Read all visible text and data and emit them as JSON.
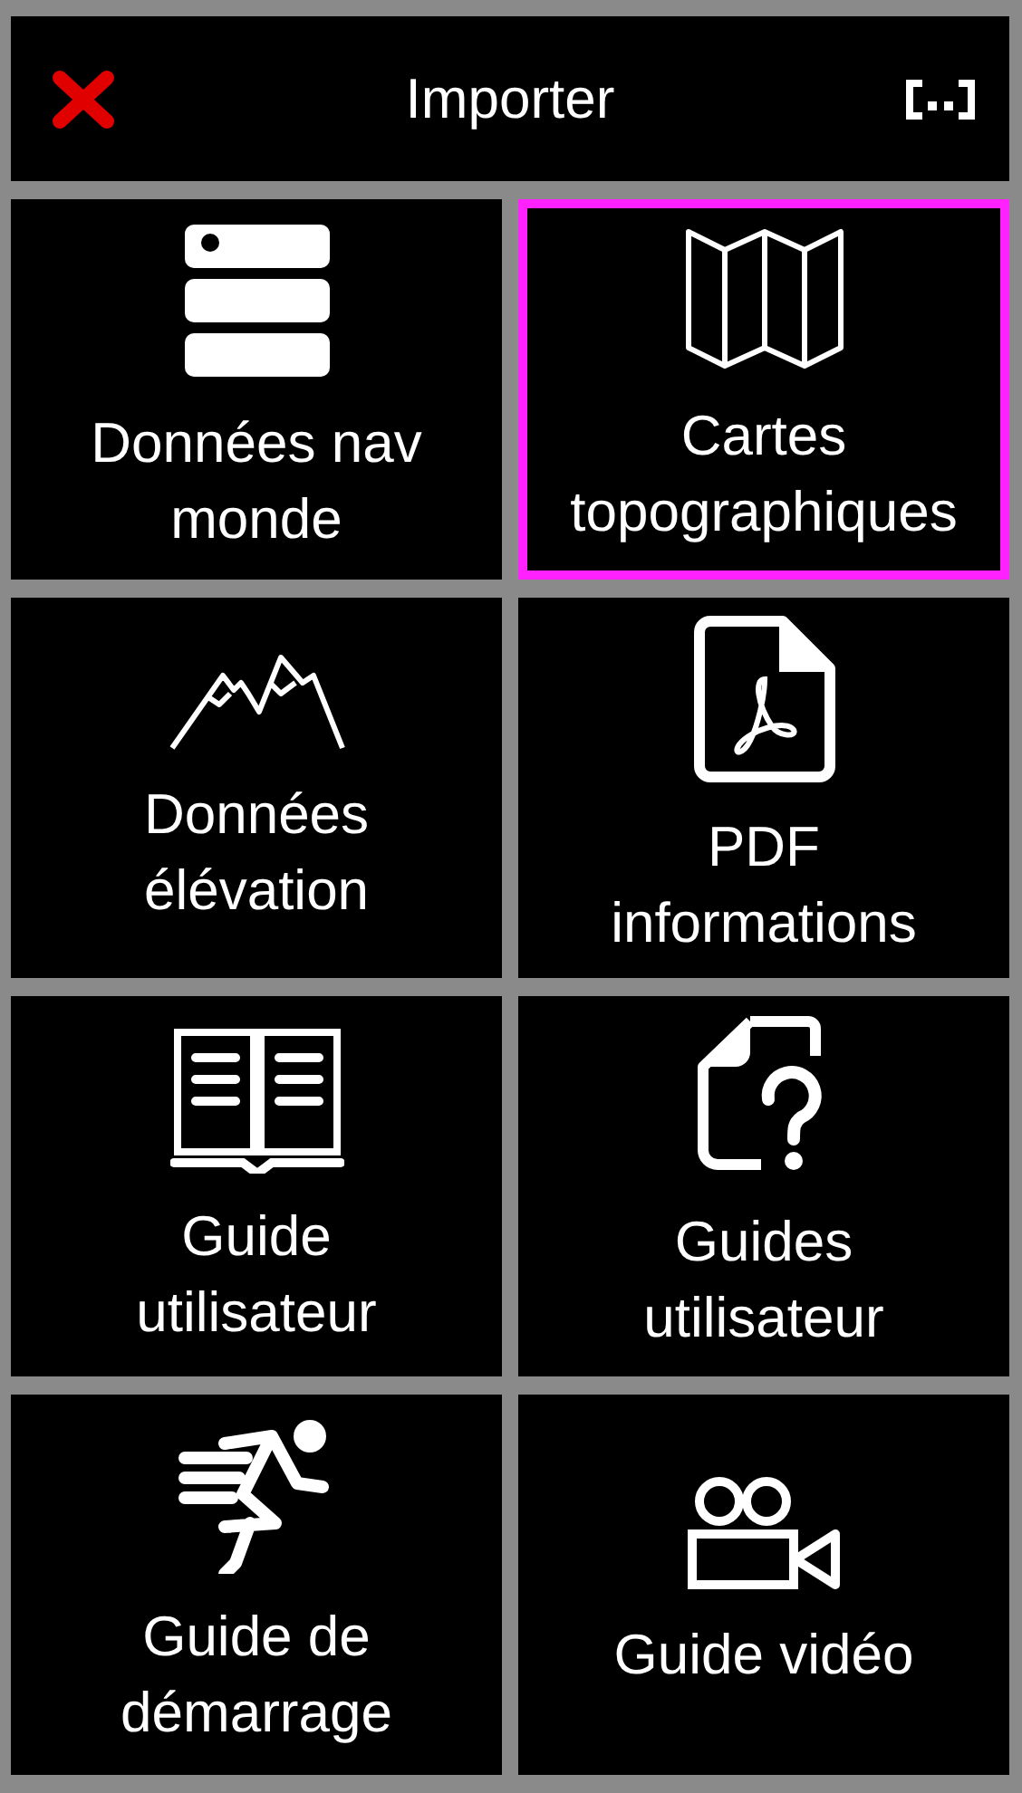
{
  "header": {
    "title": "Importer"
  },
  "tiles": [
    {
      "label": "Données nav\nmonde",
      "selected": false
    },
    {
      "label": "Cartes\ntopographiques",
      "selected": true
    },
    {
      "label": "Données\nélévation",
      "selected": false
    },
    {
      "label": "PDF\ninformations",
      "selected": false
    },
    {
      "label": "Guide\nutilisateur",
      "selected": false
    },
    {
      "label": "Guides\nutilisateur",
      "selected": false
    },
    {
      "label": "Guide de\ndémarrage",
      "selected": false
    },
    {
      "label": "Guide vidéo",
      "selected": false
    }
  ]
}
